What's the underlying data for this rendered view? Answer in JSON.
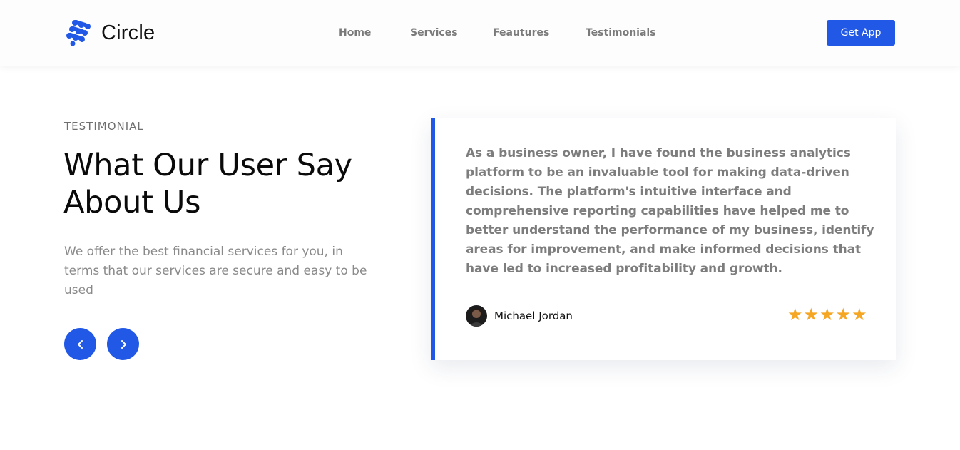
{
  "brand": {
    "name": "Circle",
    "logo_icon": "circle-dots-logo-icon",
    "accent": "#2158e6"
  },
  "nav": {
    "items": [
      {
        "label": "Home"
      },
      {
        "label": "Services"
      },
      {
        "label": "Feautures"
      },
      {
        "label": "Testimonials"
      }
    ],
    "cta_label": "Get App"
  },
  "testimonial_section": {
    "eyebrow": "TESTIMONIAL",
    "headline_line1": "What Our User Say",
    "headline_line2": "About Us",
    "lead": "We offer the best financial services for you, in terms that our services are secure and easy to be used",
    "prev_icon": "chevron-left-icon",
    "next_icon": "chevron-right-icon"
  },
  "testimonial": {
    "quote": "As a business owner, I have found the business analytics platform to be an invaluable tool for making data-driven decisions. The platform's intuitive interface and comprehensive reporting capabilities have helped me to better understand the performance of my business, identify areas for improvement, and make informed decisions that have led to increased profitability and growth.",
    "author": "Michael Jordan",
    "rating": 5,
    "stars": "★★★★★",
    "star_color": "#f5a623"
  }
}
